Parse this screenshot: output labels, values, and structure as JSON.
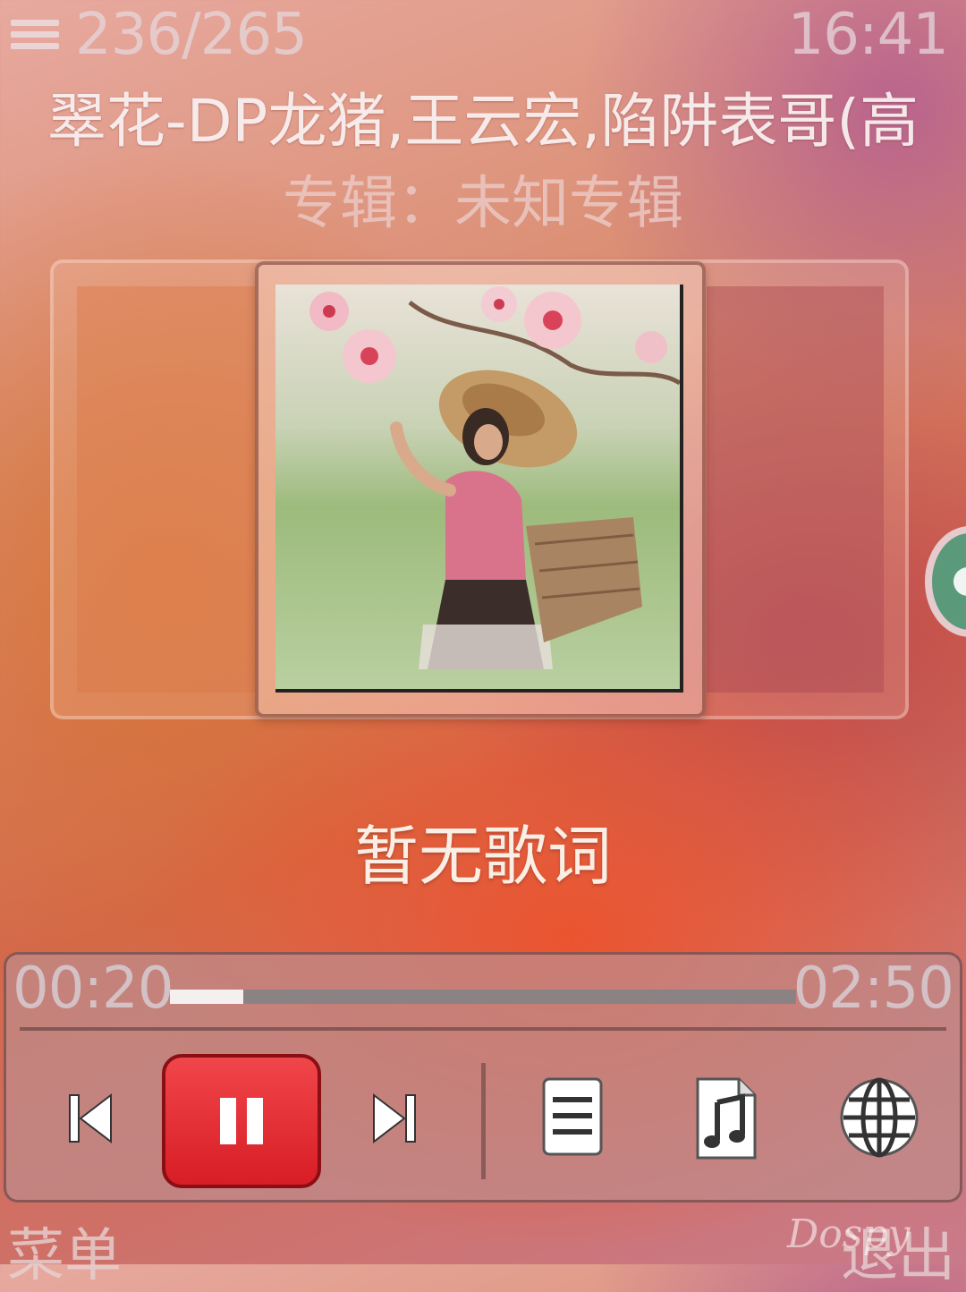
{
  "header": {
    "track_index": "236/265",
    "clock": "16:41",
    "song_title": "翠花-DP龙猪,王云宏,陷阱表哥(高",
    "album_line": "专辑：未知专辑"
  },
  "lyrics": {
    "text": "暂无歌词"
  },
  "player": {
    "elapsed": "00:20",
    "total": "02:50",
    "progress": 0.117,
    "state": "playing"
  },
  "controls": {
    "prev_icon": "skip-previous-icon",
    "pause_icon": "pause-icon",
    "next_icon": "skip-next-icon",
    "playlist_icon": "playlist-icon",
    "music_file_icon": "music-file-icon",
    "web_icon": "globe-icon",
    "accent_color": "#e0252c"
  },
  "softkeys": {
    "left": "菜单",
    "right": "退出"
  },
  "watermark": "Dospy"
}
